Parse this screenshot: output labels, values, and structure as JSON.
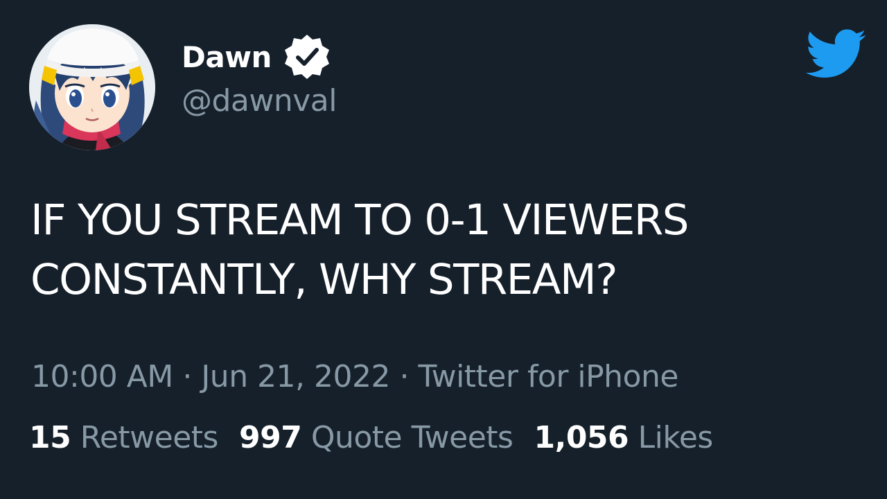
{
  "author": {
    "display_name": "Dawn",
    "handle": "@dawnval",
    "verified": true,
    "avatar_icon": "anime-girl-avatar"
  },
  "logo_icon": "twitter-bird-icon",
  "tweet": {
    "text_line_1": "IF YOU STREAM TO 0-1 VIEWERS",
    "text_line_2": "CONSTANTLY, WHY STREAM?"
  },
  "meta": {
    "time": "10:00 AM",
    "separator": " · ",
    "date": "Jun 21, 2022",
    "source": "Twitter for iPhone"
  },
  "stats": {
    "retweets_count": "15",
    "retweets_label": "Retweets",
    "quotes_count": "997",
    "quotes_label": "Quote Tweets",
    "likes_count": "1,056",
    "likes_label": "Likes"
  },
  "colors": {
    "background": "#15202b",
    "primary_text": "#ffffff",
    "secondary_text": "#8899a6",
    "twitter_blue": "#1d9bf0"
  }
}
